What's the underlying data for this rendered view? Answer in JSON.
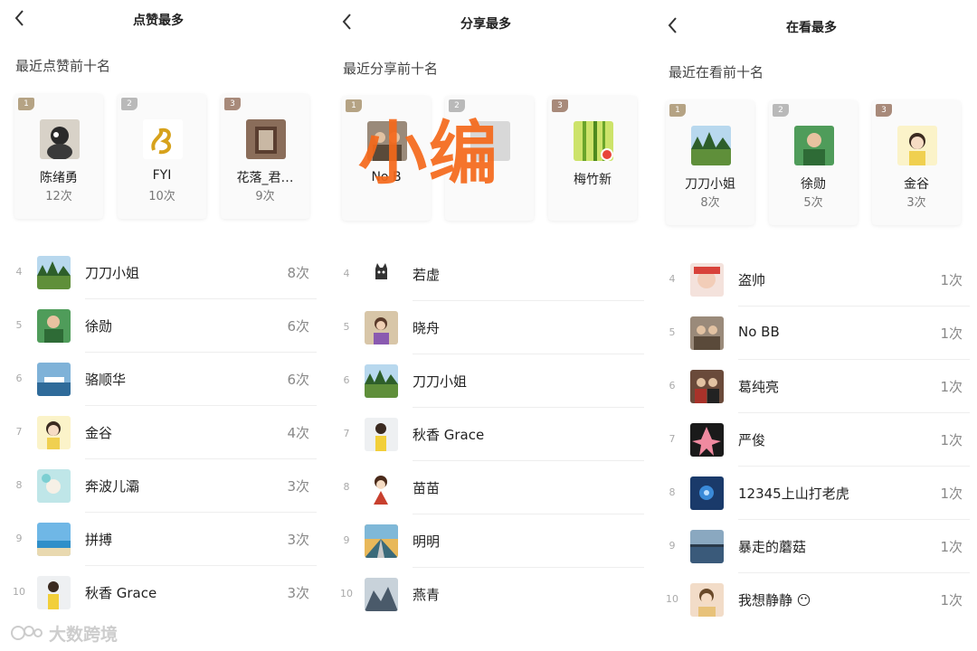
{
  "colors": {
    "badge_gold": "#b5a384",
    "badge_silver": "#b9b9b9",
    "badge_bronze": "#a88a7a",
    "overlay": "#f4681a"
  },
  "panels": [
    {
      "title": "点赞最多",
      "subtitle": "最近点赞前十名",
      "top3": [
        {
          "rank": "1",
          "name": "陈绪勇",
          "count": "12次",
          "avatar": "cartoon-avatar"
        },
        {
          "rank": "2",
          "name": "FYI",
          "count": "10次",
          "avatar": "gold-dragon-avatar"
        },
        {
          "rank": "3",
          "name": "花落_君…",
          "count": "9次",
          "avatar": "door-avatar"
        }
      ],
      "rows": [
        {
          "rank": "4",
          "name": "刀刀小姐",
          "count": "8次",
          "avatar": "forest-avatar"
        },
        {
          "rank": "5",
          "name": "徐勋",
          "count": "6次",
          "avatar": "man-green-avatar"
        },
        {
          "rank": "6",
          "name": "骆顺华",
          "count": "6次",
          "avatar": "ship-avatar"
        },
        {
          "rank": "7",
          "name": "金谷",
          "count": "4次",
          "avatar": "girl-cartoon-avatar"
        },
        {
          "rank": "8",
          "name": "奔波儿灞",
          "count": "3次",
          "avatar": "watercolor-avatar"
        },
        {
          "rank": "9",
          "name": "拼搏",
          "count": "3次",
          "avatar": "beach-avatar"
        },
        {
          "rank": "10",
          "name": "秋香 Grace",
          "count": "3次",
          "avatar": "girl-drawing-avatar"
        }
      ]
    },
    {
      "title": "分享最多",
      "subtitle": "最近分享前十名",
      "top3": [
        {
          "rank": "1",
          "name": "No B",
          "count": "",
          "avatar": "people-avatar"
        },
        {
          "rank": "2",
          "name": "",
          "count": "",
          "avatar": "hidden-avatar"
        },
        {
          "rank": "3",
          "name": "梅竹新",
          "count": "",
          "avatar": "bamboo-avatar"
        }
      ],
      "rows": [
        {
          "rank": "4",
          "name": "若虚",
          "count": "",
          "avatar": "cat-avatar"
        },
        {
          "rank": "5",
          "name": "晓舟",
          "count": "",
          "avatar": "woman-avatar"
        },
        {
          "rank": "6",
          "name": "刀刀小姐",
          "count": "",
          "avatar": "forest-avatar"
        },
        {
          "rank": "7",
          "name": "秋香 Grace",
          "count": "",
          "avatar": "girl-drawing-avatar"
        },
        {
          "rank": "8",
          "name": "苗苗",
          "count": "",
          "avatar": "girl-red-avatar"
        },
        {
          "rank": "9",
          "name": "明明",
          "count": "",
          "avatar": "railway-avatar"
        },
        {
          "rank": "10",
          "name": "燕青",
          "count": "",
          "avatar": "mountain-avatar"
        }
      ]
    },
    {
      "title": "在看最多",
      "subtitle": "最近在看前十名",
      "top3": [
        {
          "rank": "1",
          "name": "刀刀小姐",
          "count": "8次",
          "avatar": "forest-avatar"
        },
        {
          "rank": "2",
          "name": "徐勋",
          "count": "5次",
          "avatar": "man-green-avatar"
        },
        {
          "rank": "3",
          "name": "金谷",
          "count": "3次",
          "avatar": "girl-cartoon-avatar"
        }
      ],
      "rows": [
        {
          "rank": "4",
          "name": "盗帅",
          "count": "1次",
          "avatar": "baby-avatar"
        },
        {
          "rank": "5",
          "name": "No BB",
          "count": "1次",
          "avatar": "people-avatar"
        },
        {
          "rank": "6",
          "name": "葛纯亮",
          "count": "1次",
          "avatar": "couple-avatar"
        },
        {
          "rank": "7",
          "name": "严俊",
          "count": "1次",
          "avatar": "patrick-avatar"
        },
        {
          "rank": "8",
          "name": "12345上山打老虎",
          "count": "1次",
          "avatar": "night-avatar"
        },
        {
          "rank": "9",
          "name": "暴走的蘑菇",
          "count": "1次",
          "avatar": "lake-avatar"
        },
        {
          "rank": "10",
          "name": "我想静静 😶",
          "count": "1次",
          "avatar": "girl-selfie-avatar"
        }
      ]
    }
  ],
  "overlay_text": "小编",
  "watermark": "大数跨境"
}
